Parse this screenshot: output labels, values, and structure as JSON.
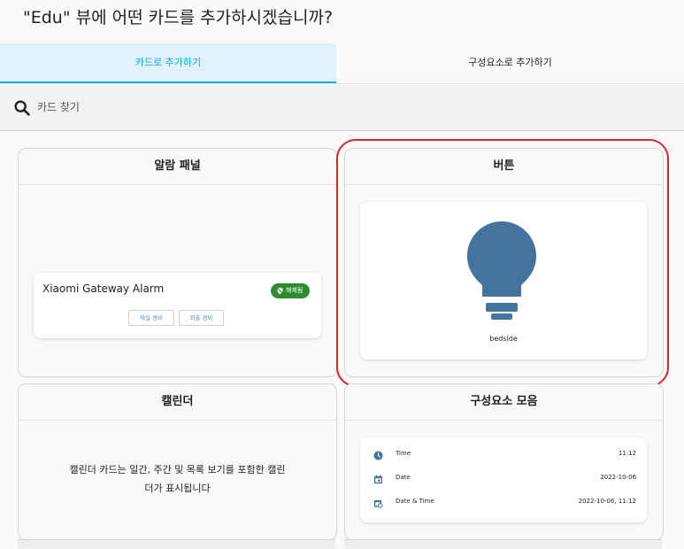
{
  "dialog": {
    "title": "\"Edu\" 뷰에 어떤 카드를 추가하시겠습니까?"
  },
  "tabs": [
    {
      "label": "카드로 추가하기",
      "active": true
    },
    {
      "label": "구성요소로 추가하기",
      "active": false
    }
  ],
  "search": {
    "placeholder": "카드 찾기",
    "value": ""
  },
  "cards": {
    "alarm": {
      "header": "알람 패널",
      "entity_name": "Xiaomi Gateway Alarm",
      "badge": "해제됨",
      "buttons": [
        "재실 경비",
        "외출 경비"
      ]
    },
    "button": {
      "header": "버튼",
      "entity_name": "bedside",
      "icon": "lightbulb-icon",
      "icon_color": "#44739e"
    },
    "calendar": {
      "header": "캘린더",
      "description_line1": "캘린더 카드는 일간, 주간 및 목록 보기를 포함한 캘린",
      "description_line2": "더가 표시됩니다"
    },
    "glance": {
      "header": "구성요소 모음",
      "rows": [
        {
          "label": "Time",
          "value": "11:12",
          "icon": "clock-icon"
        },
        {
          "label": "Date",
          "value": "2022-10-06",
          "icon": "calendar-icon"
        },
        {
          "label": "Date & Time",
          "value": "2022-10-06, 11:12",
          "icon": "calendar-clock-icon"
        }
      ]
    }
  },
  "colors": {
    "accent": "#03a9f4",
    "highlight_ring": "#d9262b",
    "badge": "#2e8b2e",
    "icon": "#44739e"
  }
}
